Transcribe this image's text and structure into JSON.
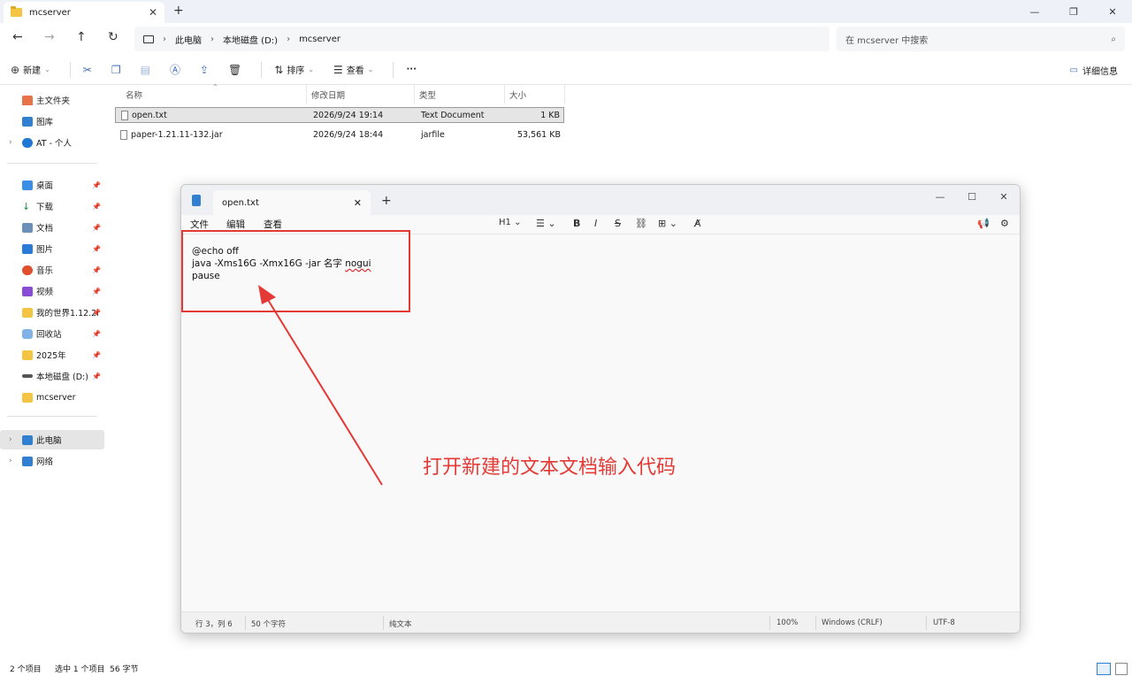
{
  "explorer": {
    "tab_title": "mcserver",
    "breadcrumb": [
      "此电脑",
      "本地磁盘 (D:)",
      "mcserver"
    ],
    "search_placeholder": "在 mcserver 中搜索",
    "commands": {
      "new": "新建",
      "sort": "排序",
      "view": "查看",
      "more": "···",
      "details": "详细信息"
    },
    "columns": [
      "名称",
      "修改日期",
      "类型",
      "大小"
    ],
    "files": [
      {
        "name": "open.txt",
        "date": "2026/9/24 19:14",
        "type": "Text Document",
        "size": "1 KB"
      },
      {
        "name": "paper-1.21.11-132.jar",
        "date": "2026/9/24 18:44",
        "type": "jarfile",
        "size": "53,561 KB"
      }
    ],
    "sidebar": {
      "top": [
        {
          "label": "主文件夹",
          "icon": "home-icon"
        },
        {
          "label": "图库",
          "icon": "gallery-icon"
        },
        {
          "label": "AT - 个人",
          "icon": "cloud-icon"
        }
      ],
      "quick": [
        {
          "label": "桌面",
          "icon": "desktop-icon"
        },
        {
          "label": "下载",
          "icon": "download-icon"
        },
        {
          "label": "文档",
          "icon": "documents-icon"
        },
        {
          "label": "图片",
          "icon": "pictures-icon"
        },
        {
          "label": "音乐",
          "icon": "music-icon"
        },
        {
          "label": "视频",
          "icon": "videos-icon"
        },
        {
          "label": "我的世界1.12.2f",
          "icon": "folder-icon"
        },
        {
          "label": "回收站",
          "icon": "recycle-bin-icon"
        },
        {
          "label": "2025年",
          "icon": "folder-icon"
        },
        {
          "label": "本地磁盘 (D:)",
          "icon": "drive-icon"
        },
        {
          "label": "mcserver",
          "icon": "folder-icon"
        }
      ],
      "bottom": [
        {
          "label": "此电脑",
          "icon": "pc-icon"
        },
        {
          "label": "网络",
          "icon": "network-icon"
        }
      ]
    },
    "status": {
      "items": "2 个项目",
      "selected": "选中 1 个项目  56 字节"
    }
  },
  "notepad": {
    "tab_title": "open.txt",
    "menus": [
      "文件",
      "编辑",
      "查看"
    ],
    "heading_tool": "H1",
    "content_lines": [
      "@echo off",
      "java -Xms16G -Xmx16G -jar 名字 ",
      "nogui",
      "pause"
    ],
    "status": {
      "position": "行 3，列 6",
      "chars": "50 个字符",
      "format": "纯文本",
      "zoom": "100%",
      "eol": "Windows (CRLF)",
      "encoding": "UTF-8"
    }
  },
  "annotation": {
    "text": "打开新建的文本文档输入代码",
    "color": "#e53935"
  }
}
